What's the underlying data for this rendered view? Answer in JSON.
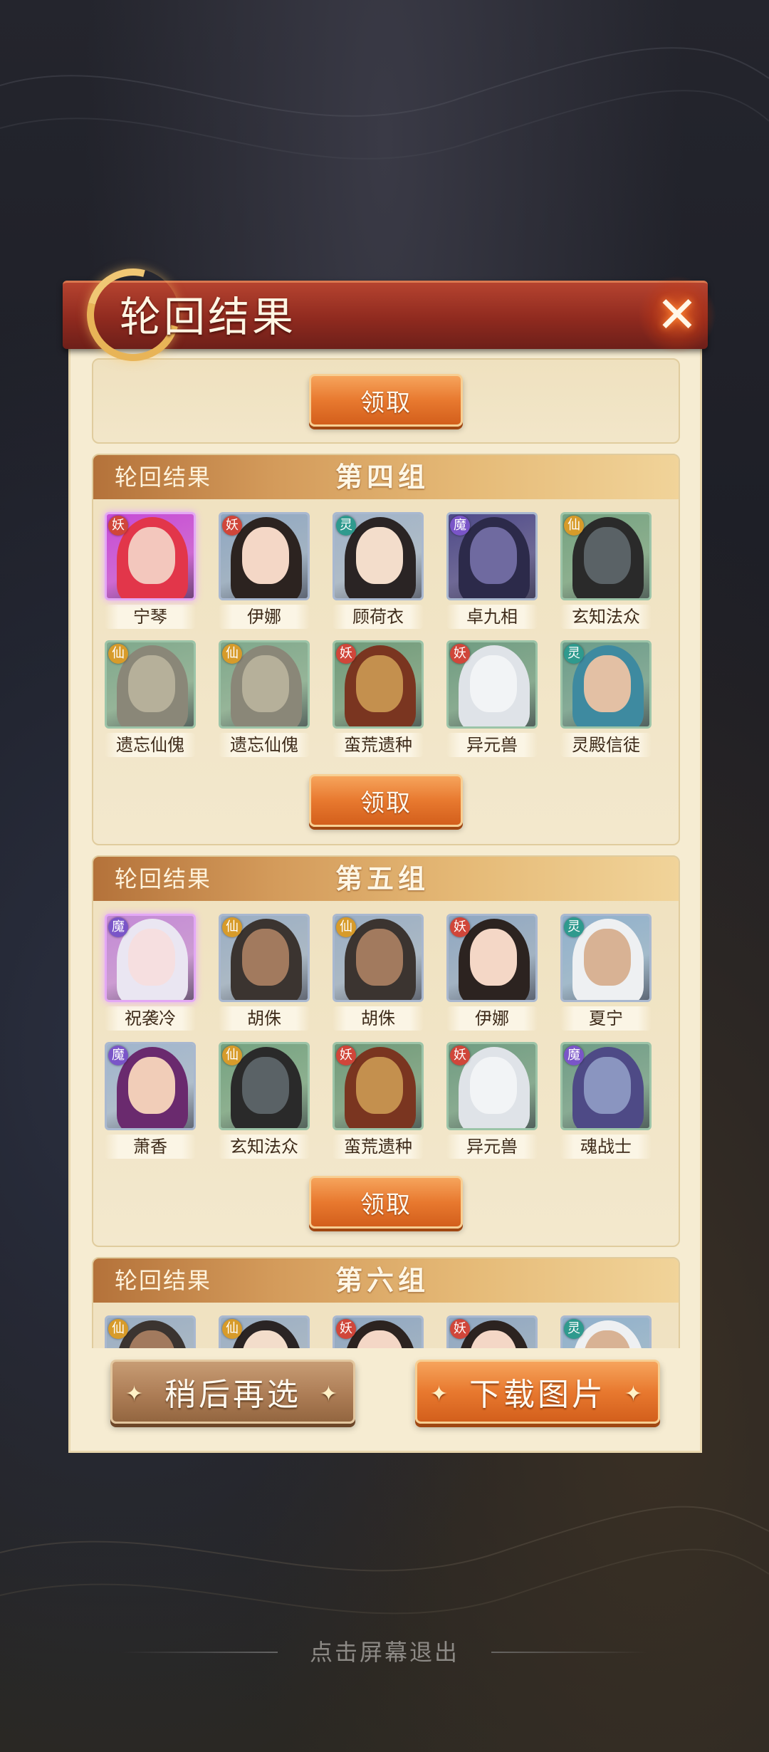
{
  "modal": {
    "title": "轮回结果",
    "close_icon": "close-x-icon",
    "claim_label": "领取"
  },
  "groups": [
    {
      "label": "轮回结果",
      "name": "第四组",
      "heroes": [
        {
          "name": "宁琴",
          "badge": "妖",
          "frame": "purple",
          "palette": [
            "#c64bd6",
            "#e2364a",
            "#f3c7bd"
          ]
        },
        {
          "name": "伊娜",
          "badge": "妖",
          "frame": "blue",
          "palette": [
            "#8fa7c2",
            "#2c2320",
            "#f4d7c6"
          ]
        },
        {
          "name": "顾荷衣",
          "badge": "灵",
          "frame": "blue",
          "palette": [
            "#9fb2c8",
            "#2a2424",
            "#f3ddcb"
          ]
        },
        {
          "name": "卓九相",
          "badge": "魔",
          "frame": "blue",
          "palette": [
            "#4e4a8a",
            "#2c2a4a",
            "#6f6aa0"
          ]
        },
        {
          "name": "玄知法众",
          "badge": "仙",
          "frame": "green",
          "palette": [
            "#74a281",
            "#2a2a2a",
            "#5a6266"
          ]
        },
        {
          "name": "遗忘仙傀",
          "badge": "仙",
          "frame": "green",
          "palette": [
            "#7fa88c",
            "#8a8778",
            "#b6b09a"
          ]
        },
        {
          "name": "遗忘仙傀",
          "badge": "仙",
          "frame": "green",
          "palette": [
            "#7fa88c",
            "#8a8778",
            "#b6b09a"
          ]
        },
        {
          "name": "蛮荒遗种",
          "badge": "妖",
          "frame": "green",
          "palette": [
            "#6f9a7a",
            "#7a3520",
            "#c4904e"
          ]
        },
        {
          "name": "异元兽",
          "badge": "妖",
          "frame": "green",
          "palette": [
            "#6f9c82",
            "#dfe3e8",
            "#f2f4f6"
          ]
        },
        {
          "name": "灵殿信徒",
          "badge": "灵",
          "frame": "green",
          "palette": [
            "#6b9c8a",
            "#3e8aa0",
            "#e3c0a4"
          ]
        }
      ]
    },
    {
      "label": "轮回结果",
      "name": "第五组",
      "heroes": [
        {
          "name": "祝袭冷",
          "badge": "魔",
          "frame": "purple",
          "palette": [
            "#c38ad6",
            "#eae6f2",
            "#f6dfe0"
          ]
        },
        {
          "name": "胡侏",
          "badge": "仙",
          "frame": "blue",
          "palette": [
            "#9aaec4",
            "#3b3430",
            "#a27a5e"
          ]
        },
        {
          "name": "胡侏",
          "badge": "仙",
          "frame": "blue",
          "palette": [
            "#9aaec4",
            "#3b3430",
            "#a27a5e"
          ]
        },
        {
          "name": "伊娜",
          "badge": "妖",
          "frame": "blue",
          "palette": [
            "#8fa7c2",
            "#2c2320",
            "#f4d7c6"
          ]
        },
        {
          "name": "夏宁",
          "badge": "灵",
          "frame": "blue",
          "palette": [
            "#8fb0cc",
            "#eef0f2",
            "#d8b294"
          ]
        },
        {
          "name": "萧香",
          "badge": "魔",
          "frame": "blue",
          "palette": [
            "#9fb4cc",
            "#6a2a6e",
            "#f1cdb8"
          ]
        },
        {
          "name": "玄知法众",
          "badge": "仙",
          "frame": "green",
          "palette": [
            "#74a281",
            "#2a2a2a",
            "#5a6266"
          ]
        },
        {
          "name": "蛮荒遗种",
          "badge": "妖",
          "frame": "green",
          "palette": [
            "#6f9a7a",
            "#7a3520",
            "#c4904e"
          ]
        },
        {
          "name": "异元兽",
          "badge": "妖",
          "frame": "green",
          "palette": [
            "#6f9c82",
            "#dfe3e8",
            "#f2f4f6"
          ]
        },
        {
          "name": "魂战士",
          "badge": "魔",
          "frame": "green",
          "palette": [
            "#6e9c86",
            "#4e4a86",
            "#8a95c0"
          ]
        }
      ]
    },
    {
      "label": "轮回结果",
      "name": "第六组",
      "heroes": [
        {
          "name": "",
          "badge": "仙",
          "frame": "blue",
          "palette": [
            "#9aaec4",
            "#3b3430",
            "#a27a5e"
          ]
        },
        {
          "name": "",
          "badge": "仙",
          "frame": "blue",
          "palette": [
            "#9aaec4",
            "#2a2424",
            "#f3ddcb"
          ]
        },
        {
          "name": "",
          "badge": "妖",
          "frame": "blue",
          "palette": [
            "#8fa7c2",
            "#2c2320",
            "#f4d7c6"
          ]
        },
        {
          "name": "",
          "badge": "妖",
          "frame": "blue",
          "palette": [
            "#8fa7c2",
            "#2c2320",
            "#f4d7c6"
          ]
        },
        {
          "name": "",
          "badge": "灵",
          "frame": "blue",
          "palette": [
            "#8fb0cc",
            "#eef0f2",
            "#d8b294"
          ]
        }
      ]
    }
  ],
  "footer": {
    "later_label": "稍后再选",
    "download_label": "下载图片"
  },
  "exit_hint": "点击屏幕退出",
  "colors": {
    "badge_妖": "#d0463a",
    "badge_灵": "#2f9a8e",
    "badge_魔": "#7a55c8",
    "badge_仙": "#d79b2a",
    "frame_purple": "#e3a8f5",
    "frame_blue": "#a9b8d0",
    "frame_green": "#9cc4a8"
  }
}
